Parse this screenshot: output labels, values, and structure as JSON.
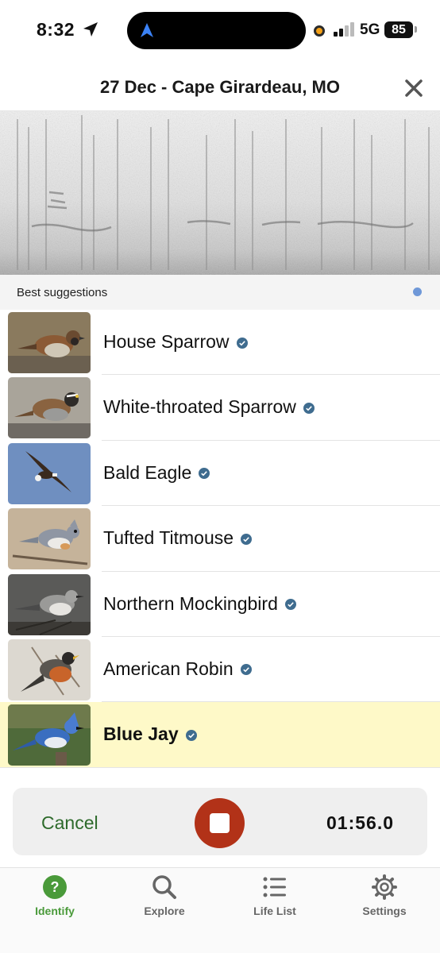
{
  "status_bar": {
    "time": "8:32",
    "network": "5G",
    "battery": "85"
  },
  "header": {
    "title": "27 Dec - Cape Girardeau, MO",
    "close_icon": "close-icon"
  },
  "suggestions": {
    "title": "Best suggestions",
    "items": [
      {
        "name": "House Sparrow",
        "icon": "verified-check-icon",
        "highlighted": false
      },
      {
        "name": "White-throated Sparrow",
        "icon": "verified-check-icon",
        "highlighted": false
      },
      {
        "name": "Bald Eagle",
        "icon": "verified-check-icon",
        "highlighted": false
      },
      {
        "name": "Tufted Titmouse",
        "icon": "verified-check-icon",
        "highlighted": false
      },
      {
        "name": "Northern Mockingbird",
        "icon": "verified-check-icon",
        "highlighted": false
      },
      {
        "name": "American Robin",
        "icon": "verified-check-icon",
        "highlighted": false
      },
      {
        "name": "Blue Jay",
        "icon": "verified-check-icon",
        "highlighted": true
      }
    ]
  },
  "recorder": {
    "cancel_label": "Cancel",
    "timer": "01:56.0",
    "stop_color": "#b23218"
  },
  "tab_bar": {
    "tabs": [
      {
        "label": "Identify",
        "icon": "question-circle-icon",
        "active": true
      },
      {
        "label": "Explore",
        "icon": "search-icon",
        "active": false
      },
      {
        "label": "Life List",
        "icon": "list-icon",
        "active": false
      },
      {
        "label": "Settings",
        "icon": "gear-icon",
        "active": false
      }
    ]
  },
  "colors": {
    "accent_green": "#4a9a3a",
    "cancel_green": "#2d6a2b",
    "highlight_row": "#fef9c8",
    "badge_blue": "#3f6c8f"
  }
}
